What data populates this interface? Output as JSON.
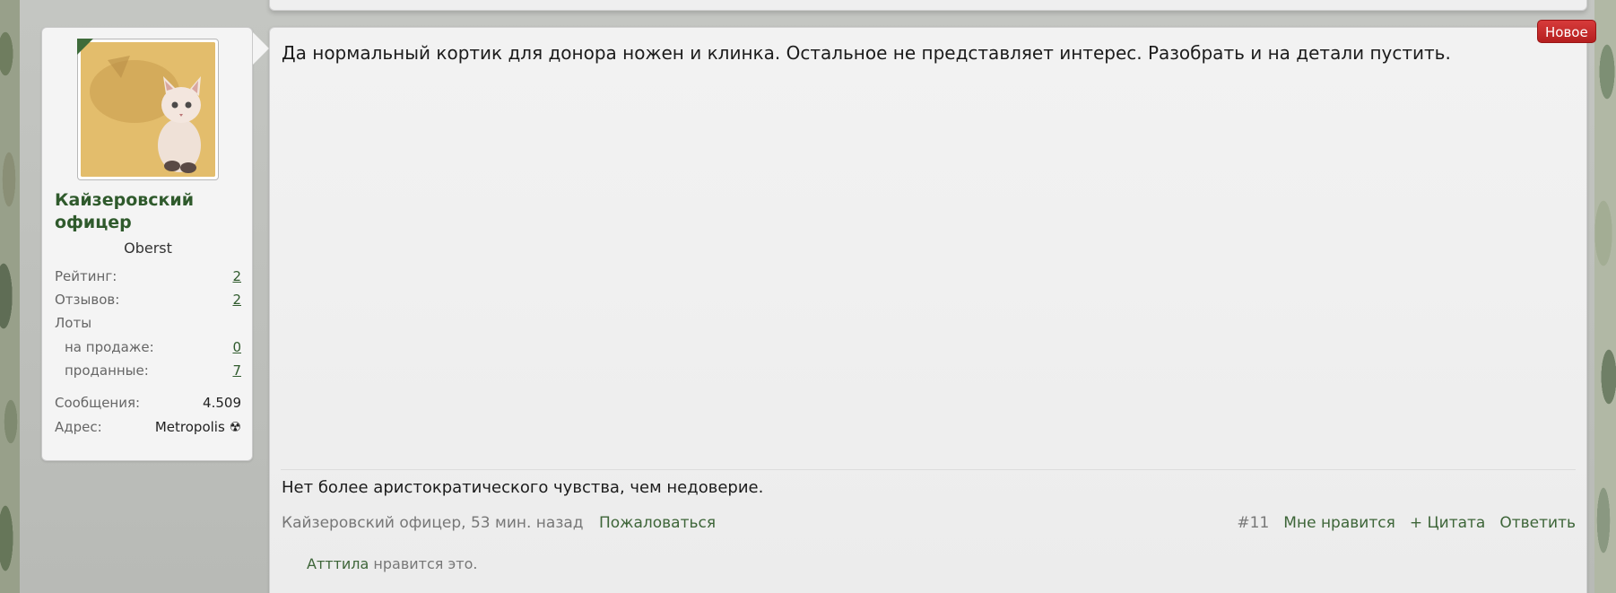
{
  "post": {
    "badge_new": "Новое",
    "text": "Да нормальный кортик для донора ножен и клинка. Остальное не представляет интерес. Разобрать и на детали пустить.",
    "signature": "Нет более аристократического чувства, чем недоверие.",
    "meta_author_time": "Кайзеровский офицер, 53 мин. назад",
    "report_label": "Пожаловаться",
    "post_number": "#11",
    "like_label": "Мне нравится",
    "quote_label": "+ Цитата",
    "reply_label": "Ответить",
    "likes_user": "Атттила",
    "likes_text": " нравится это."
  },
  "user": {
    "name": "Кайзеровский офицер",
    "title": "Oberst",
    "stats": {
      "rating_label": "Рейтинг:",
      "rating_value": "2",
      "reviews_label": "Отзывов:",
      "reviews_value": "2",
      "lots_label": "Лоты",
      "on_sale_label": "на продаже:",
      "on_sale_value": "0",
      "sold_label": "проданные:",
      "sold_value": "7",
      "messages_label": "Сообщения:",
      "messages_value": "4.509",
      "address_label": "Адрес:",
      "address_value": "Metropolis ☢"
    }
  }
}
